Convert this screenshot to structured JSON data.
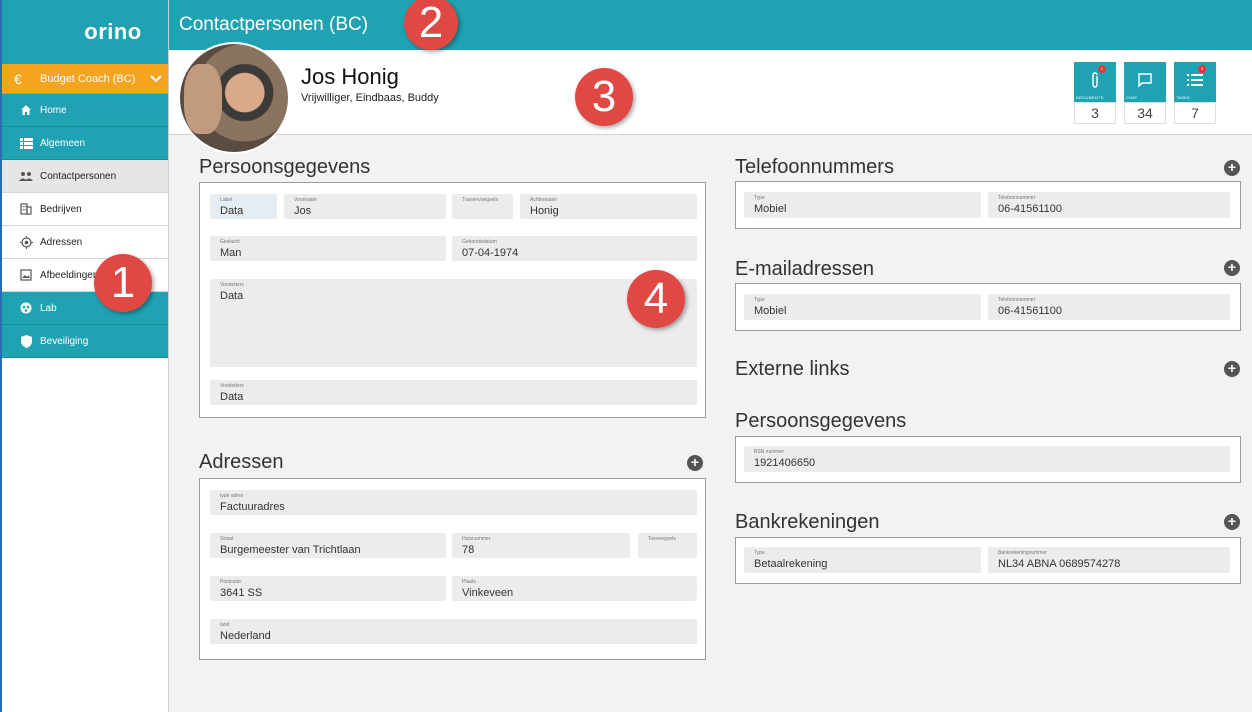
{
  "app": {
    "logo": "orino",
    "page_title": "Contactpersonen (BC)"
  },
  "sidebar": {
    "budget": {
      "icon": "euro-icon",
      "label": "Budget Coach (BC)"
    },
    "items": [
      {
        "label": "Home",
        "icon": "home-icon",
        "style": "teal"
      },
      {
        "label": "Algemeen",
        "icon": "list-icon",
        "style": "teal"
      },
      {
        "label": "Contactpersonen",
        "icon": "people-icon",
        "style": "active"
      },
      {
        "label": "Bedrijven",
        "icon": "building-icon",
        "style": "white"
      },
      {
        "label": "Adressen",
        "icon": "location-icon",
        "style": "white"
      },
      {
        "label": "Afbeeldingen",
        "icon": "image-icon",
        "style": "white"
      },
      {
        "label": "Lab",
        "icon": "lab-icon",
        "style": "teal"
      },
      {
        "label": "Beveiliging",
        "icon": "shield-icon",
        "style": "teal"
      }
    ]
  },
  "profile": {
    "name": "Jos Honig",
    "roles": "Vrijwilliger, Eindbaas, Buddy"
  },
  "tiles": [
    {
      "label": "DOCUMENTS",
      "count": "3",
      "badge": "1",
      "icon": "paperclip-icon"
    },
    {
      "label": "CHAT",
      "count": "34",
      "badge": "",
      "icon": "chat-icon"
    },
    {
      "label": "TASKS",
      "count": "7",
      "badge": "3",
      "icon": "tasks-icon"
    }
  ],
  "callouts": [
    "1",
    "2",
    "3",
    "4"
  ],
  "persoonsgegevens": {
    "title": "Persoonsgegevens",
    "label_label": "Label",
    "label_value": "Data",
    "voornaam_label": "Voornaam",
    "voornaam_value": "Jos",
    "tussenvoegsels_label": "Tussenvoegsels",
    "achternaam_label": "Achternaam",
    "achternaam_value": "Honig",
    "geslacht_label": "Geslacht",
    "geslacht_value": "Man",
    "geboortedatum_label": "Geboortedatum",
    "geboortedatum_value": "07-04-1974",
    "voorletters1_label": "Voorletters",
    "voorletters1_value": "Data",
    "voorletters2_label": "Voorletters",
    "voorletters2_value": "Data"
  },
  "adressen": {
    "title": "Adressen",
    "type_label": "type adres",
    "type_value": "Factuuradres",
    "straat_label": "Straat",
    "straat_value": "Burgemeester van Trichtlaan",
    "huisnummer_label": "Huisnummer",
    "huisnummer_value": "78",
    "toevoegsels_label": "Toevoegsels",
    "postcode_label": "Postcode",
    "postcode_value": "3641 SS",
    "plaats_label": "Plaats",
    "plaats_value": "Vinkeveen",
    "land_label": "land",
    "land_value": "Nederland"
  },
  "telefoon": {
    "title": "Telefoonnummers",
    "type_label": "Type",
    "type_value": "Mobiel",
    "nr_label": "Telefoonnummer",
    "nr_value": "06-41561100"
  },
  "email": {
    "title": "E-mailadressen",
    "type_label": "Type",
    "type_value": "Mobiel",
    "nr_label": "Telefoonnummer",
    "nr_value": "06-41561100"
  },
  "externe": {
    "title": "Externe links"
  },
  "persoon2": {
    "title": "Persoonsgegevens",
    "bsn_label": "BSN nummer",
    "bsn_value": "1921406650"
  },
  "bank": {
    "title": "Bankrekeningen",
    "type_label": "Type",
    "type_value": "Betaalrekening",
    "nr_label": "Bankrekeningnummer",
    "nr_value": "NL34 ABNA 0689574278"
  }
}
